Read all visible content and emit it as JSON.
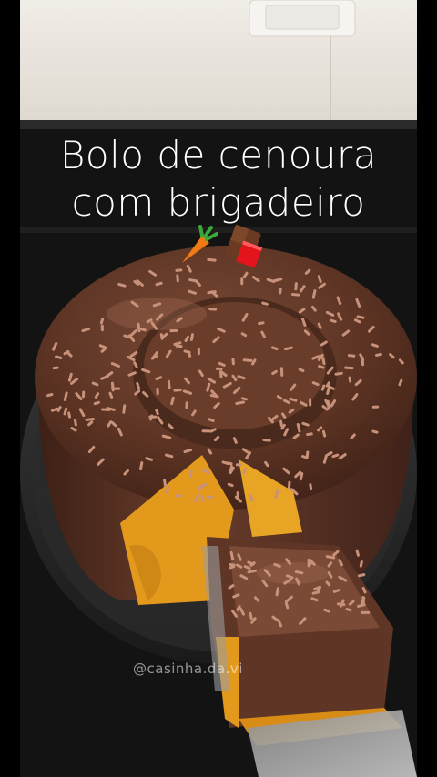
{
  "caption": {
    "line1": "Bolo de cenoura",
    "line2": "com brigadeiro"
  },
  "emojis": [
    "carrot-icon",
    "chocolate-bar-icon"
  ],
  "watermark": "@casinha.da.vi",
  "colors": {
    "wall": "#ece8e1",
    "counter": "#121212",
    "ganache": "#5a3223",
    "cake": "#e39a1c",
    "sprinkle": "#c08a6a",
    "text": "#ffffff"
  }
}
